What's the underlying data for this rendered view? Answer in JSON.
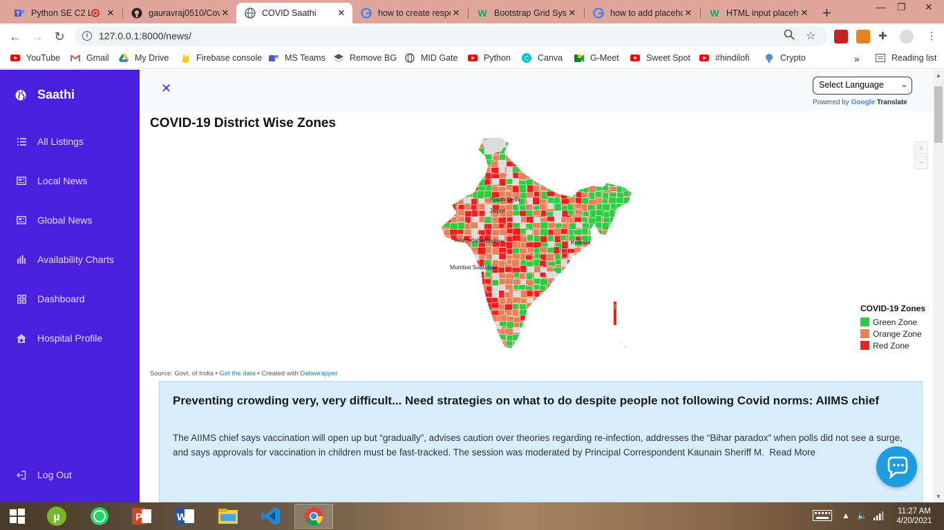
{
  "browser": {
    "tabs": [
      {
        "label": "Python SE C2 L",
        "icon": "teams-icon",
        "active": false
      },
      {
        "label": "gauravraj0510/Covi",
        "icon": "github-icon",
        "active": false
      },
      {
        "label": "COVID Saathi",
        "icon": "globe-icon",
        "active": true
      },
      {
        "label": "how to create respo",
        "icon": "google-icon",
        "active": false
      },
      {
        "label": "Bootstrap Grid Syst",
        "icon": "w3schools-icon",
        "active": false
      },
      {
        "label": "how to add placeho",
        "icon": "google-icon",
        "active": false
      },
      {
        "label": "HTML input placeh",
        "icon": "w3schools-icon",
        "active": false
      }
    ],
    "url": "127.0.0.1:8000/news/",
    "bookmarks": [
      {
        "label": "YouTube",
        "icon": "youtube-icon"
      },
      {
        "label": "Gmail",
        "icon": "gmail-icon"
      },
      {
        "label": "My Drive",
        "icon": "drive-icon"
      },
      {
        "label": "Firebase console",
        "icon": "firebase-icon"
      },
      {
        "label": "MS Teams",
        "icon": "teams-icon"
      },
      {
        "label": "Remove BG",
        "icon": "removebg-icon"
      },
      {
        "label": "MID Gate",
        "icon": "globe-icon"
      },
      {
        "label": "Python",
        "icon": "youtube-icon"
      },
      {
        "label": "Canva",
        "icon": "canva-icon"
      },
      {
        "label": "G-Meet",
        "icon": "meet-icon"
      },
      {
        "label": "Sweet Spot",
        "icon": "youtube-icon"
      },
      {
        "label": "#hindilofi",
        "icon": "youtube-icon"
      },
      {
        "label": "Crypto",
        "icon": "crypto-icon"
      }
    ],
    "reading_list": "Reading list",
    "more_bookmarks": "»"
  },
  "sidebar": {
    "brand": "Saathi",
    "items": [
      {
        "label": "All Listings",
        "icon": "list-icon"
      },
      {
        "label": "Local News",
        "icon": "newspaper-icon"
      },
      {
        "label": "Global News",
        "icon": "newspaper-icon"
      },
      {
        "label": "Availability Charts",
        "icon": "bar-chart-icon"
      },
      {
        "label": "Dashboard",
        "icon": "dashboard-grid-icon"
      },
      {
        "label": "Hospital Profile",
        "icon": "hospital-icon"
      }
    ],
    "logout": "Log Out"
  },
  "translate": {
    "select_label": "Select Language",
    "powered_by": "Powered by",
    "google": "Google",
    "translate": "Translate"
  },
  "map": {
    "title": "COVID-19 District Wise Zones",
    "cities": [
      "South Delhi",
      "Jaipur",
      "Ahmedabad",
      "Indore",
      "Kolkata",
      "Mumbai Suburban"
    ],
    "legend_title": "COVID-19 Zones",
    "legend": [
      {
        "label": "Green Zone",
        "color": "#2ecc40"
      },
      {
        "label": "Orange Zone",
        "color": "#e8805a"
      },
      {
        "label": "Red Zone",
        "color": "#f31d1d"
      }
    ],
    "zoom_in": "+",
    "zoom_out": "−",
    "source_prefix": "Source: Govt. of India • ",
    "get_data": "Get the data",
    "created_with": " • Created with ",
    "datawrapper": "Datawrapper"
  },
  "news": {
    "title": "Preventing crowding very, very difficult... Need strategies on what to do despite people not following Covid norms: AIIMS chief",
    "body": "The AIIMS chief says vaccination will open up but “gradually”, advises caution over theories regarding re-infection, addresses the “Bihar paradox” when polls did not see a surge, and says approvals for vaccination in children must be fast-tracked. The session was moderated by Principal Correspondent Kaunain Sheriff M.",
    "read_more": "Read More"
  },
  "taskbar": {
    "time": "11:27 AM",
    "date": "4/20/2021"
  },
  "colors": {
    "sidebar": "#4a1fdf",
    "accent": "#4a1fdf",
    "news_card": "#d8eefe",
    "chat": "#1e9ce0"
  }
}
